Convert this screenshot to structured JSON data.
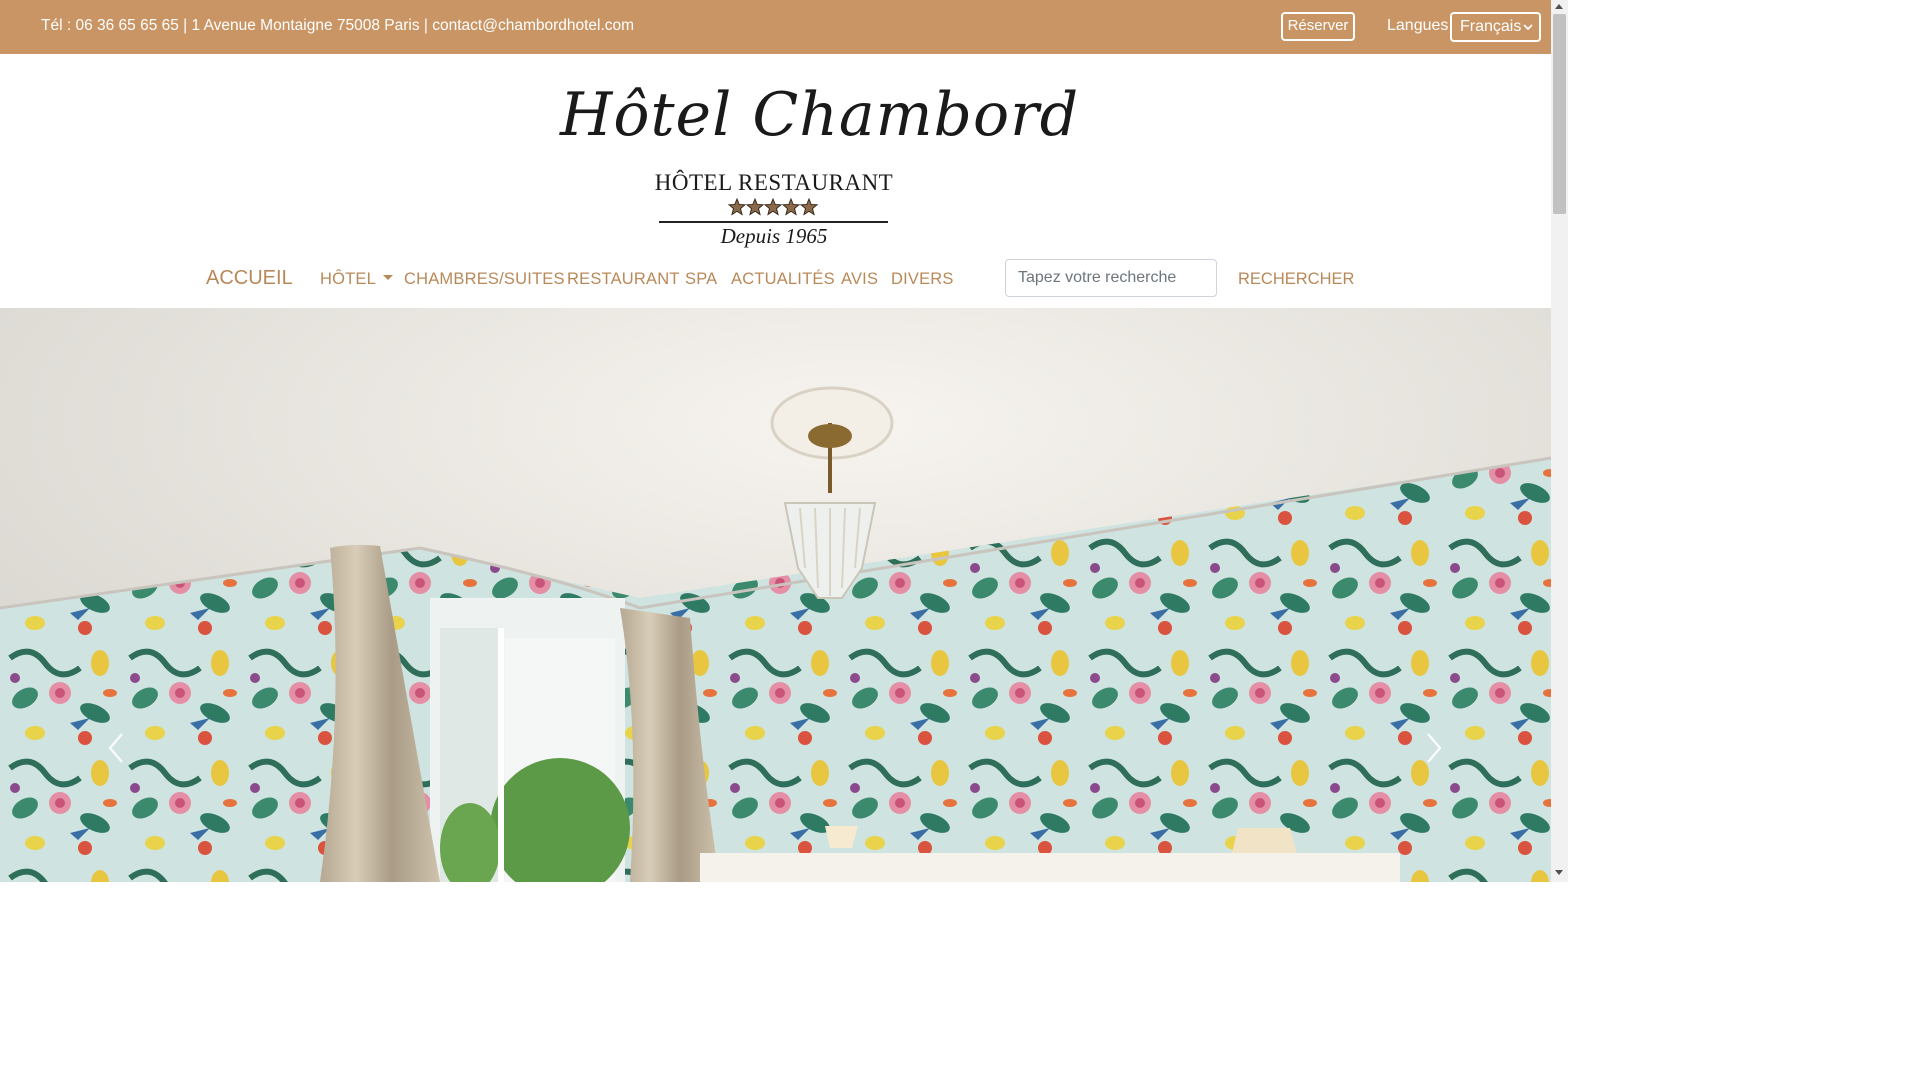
{
  "topbar": {
    "contact": "Tél : 06 36 65 65 65 | 1 Avenue Montaigne 75008 Paris | contact@chambordhotel.com",
    "reserve_label": "Réserver",
    "languages_label": "Langues",
    "language_selected": "Français",
    "bg_color": "#c99565"
  },
  "logo": {
    "script": "Hôtel Chambord",
    "subtitle": "HÔTEL RESTAURANT",
    "stars": 5,
    "since": "Depuis 1965"
  },
  "nav": {
    "home": "ACCUEIL",
    "items": [
      "HÔTEL",
      "CHAMBRES/SUITES",
      "RESTAURANT",
      "SPA",
      "ACTUALITÉS",
      "AVIS",
      "DIVERS"
    ],
    "accent_color": "#b98858"
  },
  "search": {
    "placeholder": "Tapez votre recherche",
    "button_label": "RECHERCHER"
  },
  "hero": {
    "icons": [
      "chevron-left-icon",
      "chevron-right-icon"
    ]
  }
}
